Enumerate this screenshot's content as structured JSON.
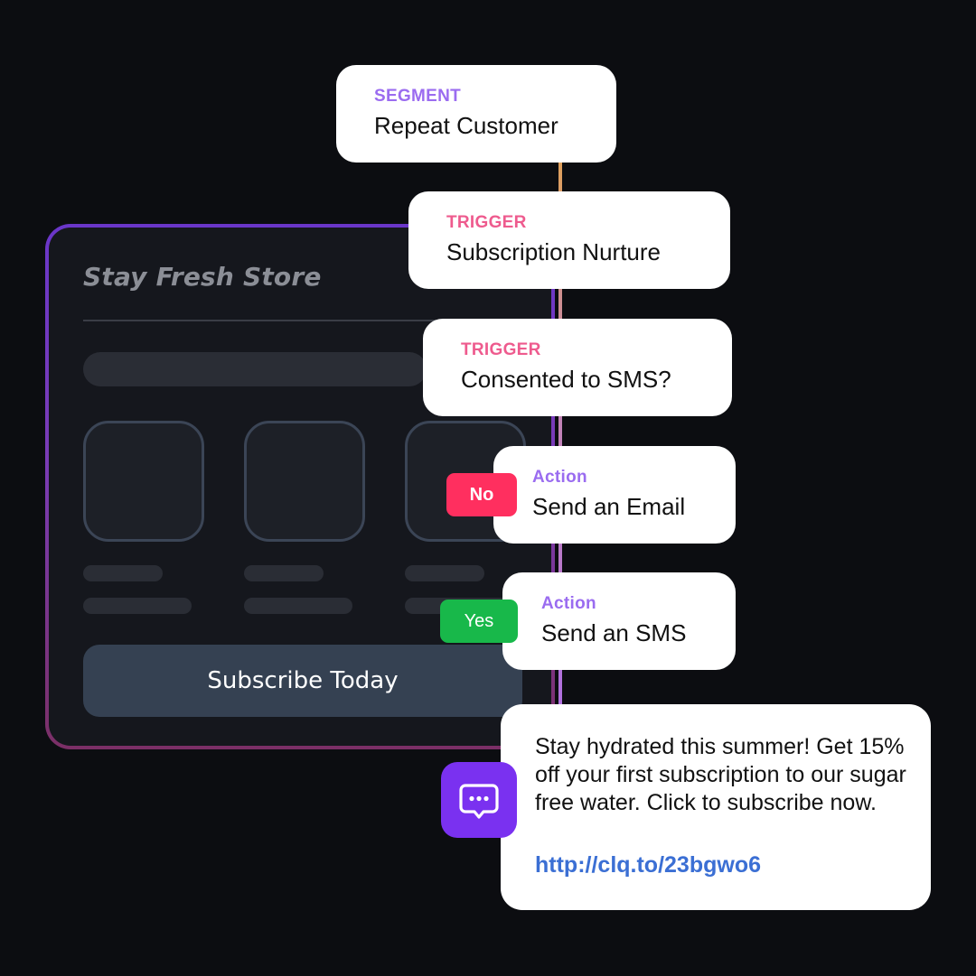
{
  "store": {
    "title": "Stay Fresh Store",
    "subscribe_label": "Subscribe Today"
  },
  "flow": {
    "segment": {
      "kicker": "SEGMENT",
      "title": "Repeat Customer"
    },
    "trigger_1": {
      "kicker": "TRIGGER",
      "title": "Subscription Nurture"
    },
    "trigger_2": {
      "kicker": "TRIGGER",
      "title": "Consented to SMS?"
    },
    "action_email": {
      "kicker": "Action",
      "title": "Send an Email",
      "branch": "No"
    },
    "action_sms": {
      "kicker": "Action",
      "title": "Send an SMS",
      "branch": "Yes"
    }
  },
  "message": {
    "icon": "chat-bubble-icon",
    "body": "Stay hydrated this summer! Get 15% off your first subscription to our sugar free water. Click to subscribe now.",
    "link": "http://clq.to/23bgwo6"
  },
  "colors": {
    "background": "#0c0d11",
    "segment_accent": "#9b6cf0",
    "trigger_accent": "#ee5b8e",
    "no_badge": "#ff2f5f",
    "yes_badge": "#18b84a",
    "link": "#3b6fd4",
    "message_icon": "#7a31f0"
  }
}
